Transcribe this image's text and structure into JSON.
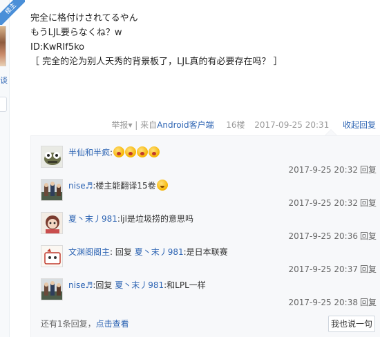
{
  "sidebar": {
    "badge": "楼主",
    "frag_text": "谈"
  },
  "post": {
    "lines": [
      "完全に格付けされてるやん",
      "もうLJL要らなくね？w",
      "ID:KwRIf5ko",
      "［ 完全的沦为别人天秀的背景板了，LJL真的有必要存在吗？ ］"
    ],
    "tail": {
      "report": "举报",
      "separator": "|",
      "from_prefix": "来自",
      "device": "Android客户端",
      "floor": "16楼",
      "time": "2017-09-25 20:31",
      "collapse": "收起回复"
    }
  },
  "replies": [
    {
      "user": "半仙和半疯",
      "colon": ":",
      "text": "",
      "emoji_count": 3,
      "emoji_kind": "shock",
      "time": "2017-9-25 20:32",
      "reply_label": "回复"
    },
    {
      "user": "nise♬",
      "colon": ":",
      "text": "楼主能翻译15卷",
      "emoji_count": 1,
      "emoji_kind": "smile",
      "time": "2017-9-25 20:32",
      "reply_label": "回复"
    },
    {
      "user": "夏丶末丿981",
      "colon": ":",
      "text": "ljl是垃圾捞的意思吗",
      "emoji_count": 0,
      "time": "2017-9-25 20:36",
      "reply_label": "回复"
    },
    {
      "user": "文渊阁阁主",
      "colon": ":",
      "reply_word": "回复",
      "target": "夏丶末丿981",
      "text": ":是日本联赛",
      "emoji_count": 0,
      "time": "2017-9-25 20:37",
      "reply_label": "回复"
    },
    {
      "user": "nise♬",
      "colon": ":",
      "reply_word": "回复",
      "target": "夏丶末丿981",
      "text": ":和LPL一样",
      "emoji_count": 0,
      "time": "2017-9-25 20:38",
      "reply_label": "回复"
    }
  ],
  "more": {
    "prefix": "还有1条回复，",
    "link": "点击查看"
  },
  "say_button": "我也说一句",
  "colors": {
    "link": "#2d64b3",
    "muted": "#999999",
    "reply_bg": "#f7f8fa"
  }
}
